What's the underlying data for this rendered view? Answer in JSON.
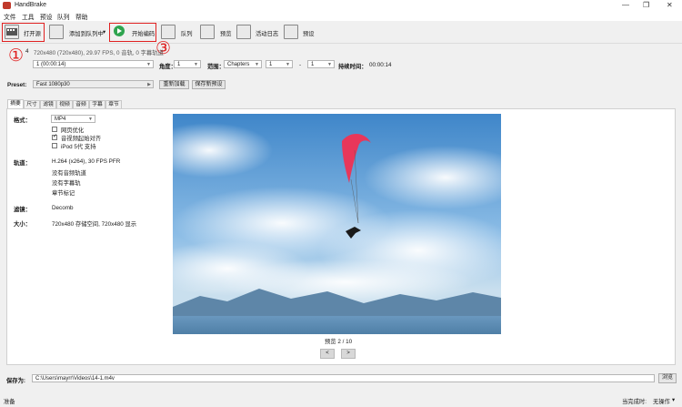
{
  "window": {
    "title": "HandBrake",
    "controls": [
      "—",
      "❐",
      "✕"
    ]
  },
  "menu": [
    "文件",
    "工具",
    "预设",
    "队列",
    "帮助"
  ],
  "toolbar": {
    "open": "打开源",
    "add_queue": "添加到队列中",
    "start": "开始编码",
    "queue": "队列",
    "preview": "预览",
    "activity_log": "活动日志",
    "presets": "预设"
  },
  "annotations": [
    "①",
    "②",
    "③"
  ],
  "source": {
    "summary": "720x480 (720x480), 29.97 FPS, 0 音轨, 0 字幕轨道",
    "prefix": "4"
  },
  "title_row": {
    "title_value": "1 (00:00:14)",
    "angle_label": "角度：",
    "angle_value": "1",
    "range_label": "范围：",
    "range_type": "Chapters",
    "range_from": "1",
    "range_dash": "-",
    "range_to": "1",
    "duration_label": "持续时间：",
    "duration_value": "00:00:14"
  },
  "preset_row": {
    "label": "Preset:",
    "value": "Fast 1080p30",
    "reload": "重新加载",
    "save_new": "保存新预设"
  },
  "tabs": [
    "摘要",
    "尺寸",
    "滤镜",
    "视频",
    "音频",
    "字幕",
    "章节"
  ],
  "summary": {
    "format_label": "格式：",
    "format_value": "MP4",
    "options": [
      {
        "label": "网页优化",
        "checked": false
      },
      {
        "label": "音视频起始对齐",
        "checked": true
      },
      {
        "label": "iPod 5代 支持",
        "checked": false
      }
    ],
    "tracks_label": "轨道：",
    "tracks": [
      "H.264 (x264), 30 FPS PFR",
      "没有音频轨道",
      "没有字幕轨",
      "章节标记"
    ],
    "filters_label": "滤镜：",
    "filters_value": "Decomb",
    "size_label": "大小：",
    "size_value": "720x480 存储空间, 720x480 显示"
  },
  "preview": {
    "caption": "预览 2 / 10",
    "prev": "<",
    "next": ">",
    "colors": {
      "sky_top": "#3f86c9",
      "sky_mid": "#8cbde6",
      "horizon": "#c9dfee",
      "mountain": "#5e86a8",
      "water": "#4f7fa6",
      "glider": "#e8375a"
    }
  },
  "save": {
    "label": "保存为:",
    "path": "C:\\Users\\mayrr\\Videos\\14-1.m4v",
    "browse": "浏览"
  },
  "status": {
    "left": "准备",
    "done_label": "当完成时:",
    "done_value": "无操作"
  }
}
